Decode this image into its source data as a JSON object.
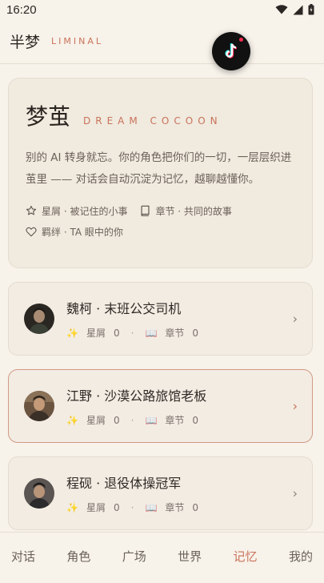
{
  "status_bar": {
    "time": "16:20"
  },
  "header": {
    "title": "半梦",
    "subtitle": "LIMINAL"
  },
  "hero": {
    "title": "梦茧",
    "subtitle": "DREAM COCOON",
    "description": "别的 AI 转身就忘。你的角色把你们的一切，一层层织进茧里 —— 对话会自动沉淀为记忆，越聊越懂你。",
    "meta": {
      "stars_label": "星屑 · 被记住的小事",
      "chapters_label": "章节 · 共同的故事",
      "bonds_label": "羁绊 · TA 眼中的你"
    }
  },
  "characters": [
    {
      "name": "魏柯 · 末班公交司机",
      "stars_label": "星屑",
      "stars": "0",
      "chapters_label": "章节",
      "chapters": "0"
    },
    {
      "name": "江野 · 沙漠公路旅馆老板",
      "stars_label": "星屑",
      "stars": "0",
      "chapters_label": "章节",
      "chapters": "0"
    },
    {
      "name": "程砚 · 退役体操冠军",
      "stars_label": "星屑",
      "stars": "0",
      "chapters_label": "章节",
      "chapters": "0"
    }
  ],
  "nav": {
    "chat": "对话",
    "roles": "角色",
    "square": "广场",
    "world": "世界",
    "memory": "记忆",
    "mine": "我的"
  },
  "colors": {
    "accent": "#c9735a",
    "background": "#f7f2ea",
    "card": "#f3ece3"
  },
  "icons": {
    "sparkle": "✨",
    "book": "📖"
  }
}
